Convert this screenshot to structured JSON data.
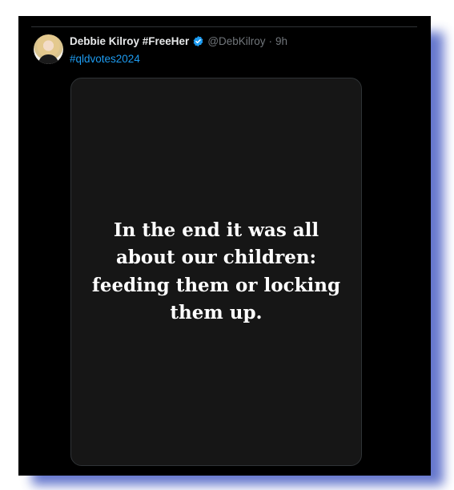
{
  "tweet": {
    "author_name": "Debbie Kilroy #FreeHer",
    "handle": "@DebKilroy",
    "separator": "·",
    "time": "9h",
    "hashtag": "#qldvotes2024",
    "media": {
      "quote_lines": [
        "In the end it was all",
        "about our children:",
        "feeding them or locking",
        "them up."
      ]
    }
  },
  "colors": {
    "background": "#000000",
    "name_text": "#e7e9ea",
    "meta_text": "#71767b",
    "link": "#1d9bf0",
    "verified_badge": "#1d9bf0",
    "media_background": "#161616",
    "frame_shadow": "#4a5fc4"
  },
  "icons": {
    "verified": "verified-badge-icon"
  }
}
